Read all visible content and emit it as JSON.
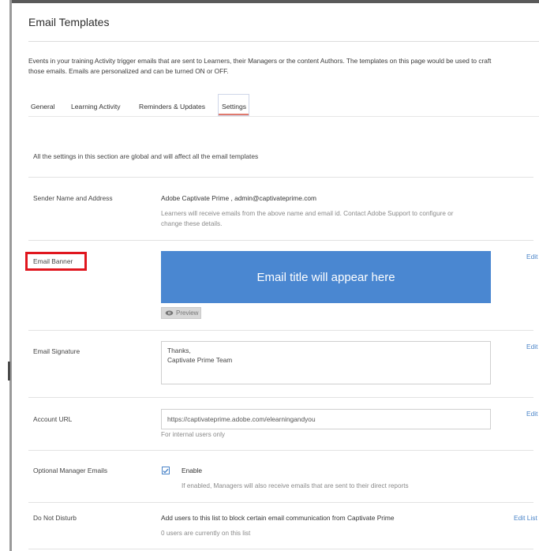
{
  "page": {
    "title": "Email Templates",
    "intro_line1": "Events in your training Activity trigger emails that are sent to Learners, their Managers or the content Authors. The templates on this page would be used to craft",
    "intro_line2": "those emails. Emails are personalized and can be turned ON or OFF."
  },
  "tabs": [
    {
      "label": "General"
    },
    {
      "label": "Learning Activity"
    },
    {
      "label": "Reminders & Updates"
    },
    {
      "label": "Settings",
      "active": true
    }
  ],
  "settings": {
    "description": "All the settings in this section are global and will affect all the email templates",
    "sender": {
      "label": "Sender Name and Address",
      "value": "Adobe Captivate Prime , admin@captivateprime.com",
      "hint_line1": "Learners will receive emails from the above name and email id. Contact Adobe Support to configure or",
      "hint_line2": "change these details."
    },
    "banner": {
      "label": "Email Banner",
      "banner_text": "Email title will appear here",
      "preview_label": "Preview",
      "edit_label": "Edit",
      "banner_color": "#4a87d1",
      "highlight_color": "#e0161e"
    },
    "signature": {
      "label": "Email Signature",
      "line1": "Thanks,",
      "line2": "Captivate Prime Team",
      "edit_label": "Edit"
    },
    "account_url": {
      "label": "Account URL",
      "value": "https://captivateprime.adobe.com/elearningandyou",
      "hint": "For internal users only",
      "edit_label": "Edit"
    },
    "manager_emails": {
      "label": "Optional Manager Emails",
      "checkbox_label": "Enable",
      "checked": true,
      "hint": "If enabled, Managers will also receive emails that are sent to their direct reports"
    },
    "do_not_disturb": {
      "label": "Do Not Disturb",
      "value": "Add users to this list to block certain email communication from Captivate Prime",
      "hint": "0 users are currently on this list",
      "edit_label": "Edit List"
    }
  },
  "icons": {
    "preview": "eye-icon",
    "checkbox": "checkmark-icon"
  },
  "colors": {
    "link": "#4a84c8",
    "tab_underline": "#e07a6e"
  }
}
